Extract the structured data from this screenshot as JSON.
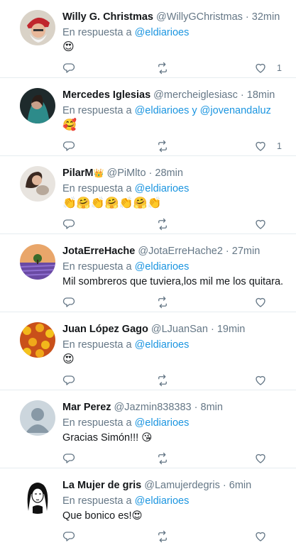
{
  "tweets": [
    {
      "name": "Willy G. Christmas",
      "handle": "@WillyGChristmas",
      "dot": "·",
      "time": "32min",
      "reply_prefix": "En respuesta a ",
      "reply_to": "@eldiarioes",
      "text": "😍",
      "likes": "1"
    },
    {
      "name": "Mercedes Iglesias",
      "handle": "@mercheiglesiasc",
      "dot": "·",
      "time": "18min",
      "reply_prefix": "En respuesta a ",
      "reply_to": "@eldiarioes y @jovenandaluz",
      "text": "🥰",
      "likes": "1"
    },
    {
      "name": "PilarM",
      "name_badge": "👑",
      "handle": "@PiMlto",
      "dot": "·",
      "time": "28min",
      "reply_prefix": "En respuesta a ",
      "reply_to": "@eldiarioes",
      "text": "👏🤗👏🤗👏🤗👏",
      "likes": ""
    },
    {
      "name": "JotaErreHache",
      "handle": "@JotaErreHache2",
      "dot": "·",
      "time": "27min",
      "reply_prefix": "En respuesta a ",
      "reply_to": "@eldiarioes",
      "text": "Mil sombreros que tuviera,los mil me los quitara.",
      "likes": ""
    },
    {
      "name": "Juan López Gago",
      "handle": "@LJuanSan",
      "dot": "·",
      "time": "19min",
      "reply_prefix": "En respuesta a ",
      "reply_to": "@eldiarioes",
      "text": "😍",
      "likes": ""
    },
    {
      "name": "Mar Perez",
      "handle": "@Jazmin838383",
      "dot": "·",
      "time": "8min",
      "reply_prefix": "En respuesta a ",
      "reply_to": "@eldiarioes",
      "text": "Gracias Simón!!! 😘",
      "likes": ""
    },
    {
      "name": "La Mujer de gris",
      "handle": "@Lamujerdegris",
      "dot": "·",
      "time": "6min",
      "reply_prefix": "En respuesta a ",
      "reply_to": "@eldiarioes",
      "text": "Que bonico es!😍",
      "likes": ""
    }
  ],
  "icons": {
    "reply": "reply-icon",
    "retweet": "retweet-icon",
    "like": "heart-icon"
  },
  "colors": {
    "link": "#1b95e0",
    "muted": "#657786",
    "text": "#14171a",
    "divider": "#e6ecf0"
  }
}
